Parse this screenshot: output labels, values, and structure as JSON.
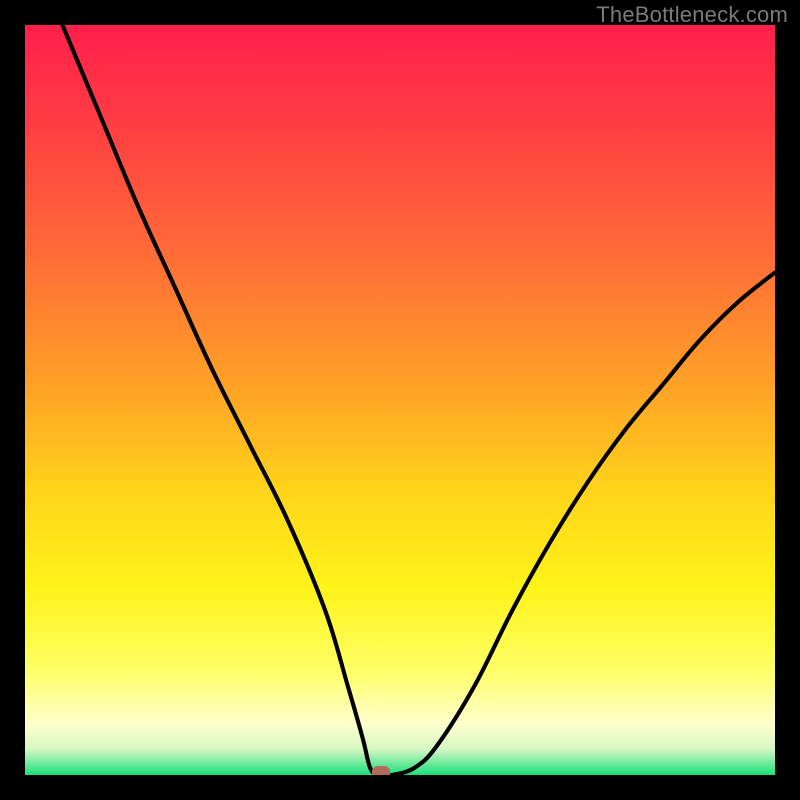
{
  "watermark": "TheBottleneck.com",
  "colors": {
    "black": "#000000",
    "curve": "#000000",
    "marker": "#b36a5e",
    "gradient_stops": [
      {
        "offset": 0.0,
        "color": "#ff1f4b"
      },
      {
        "offset": 0.12,
        "color": "#ff3a44"
      },
      {
        "offset": 0.3,
        "color": "#ff6a38"
      },
      {
        "offset": 0.48,
        "color": "#ffa126"
      },
      {
        "offset": 0.62,
        "color": "#ffd41a"
      },
      {
        "offset": 0.75,
        "color": "#fff319"
      },
      {
        "offset": 0.86,
        "color": "#ffff66"
      },
      {
        "offset": 0.93,
        "color": "#ffffcc"
      },
      {
        "offset": 0.965,
        "color": "#d7f7c4"
      },
      {
        "offset": 1.0,
        "color": "#19e07a"
      }
    ]
  },
  "chart_data": {
    "type": "line",
    "title": "",
    "xlabel": "",
    "ylabel": "",
    "xlim": [
      0,
      100
    ],
    "ylim": [
      0,
      100
    ],
    "grid": false,
    "series": [
      {
        "name": "bottleneck-curve",
        "x": [
          5,
          10,
          15,
          20,
          25,
          30,
          35,
          40,
          43,
          45,
          46,
          47,
          48,
          49,
          52,
          55,
          60,
          65,
          70,
          75,
          80,
          85,
          90,
          95,
          100
        ],
        "y": [
          100,
          88,
          76,
          65,
          54,
          44,
          34,
          22,
          12,
          5,
          1,
          0,
          0,
          0,
          1,
          4,
          12,
          22,
          31,
          39,
          46,
          52,
          58,
          63,
          67
        ]
      }
    ],
    "annotations": [
      {
        "name": "min-marker",
        "x": 47.5,
        "y": 0
      }
    ]
  }
}
